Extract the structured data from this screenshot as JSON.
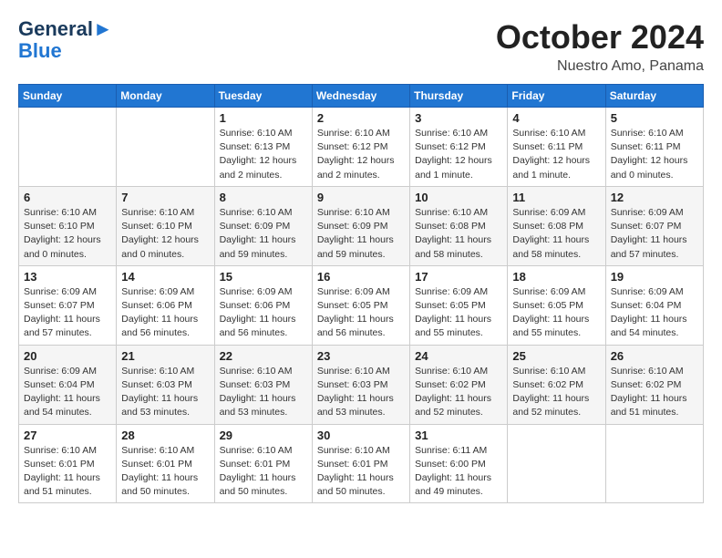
{
  "header": {
    "logo_line1": "General",
    "logo_line2": "Blue",
    "month": "October 2024",
    "location": "Nuestro Amo, Panama"
  },
  "columns": [
    "Sunday",
    "Monday",
    "Tuesday",
    "Wednesday",
    "Thursday",
    "Friday",
    "Saturday"
  ],
  "weeks": [
    [
      {
        "day": "",
        "info": ""
      },
      {
        "day": "",
        "info": ""
      },
      {
        "day": "1",
        "info": "Sunrise: 6:10 AM\nSunset: 6:13 PM\nDaylight: 12 hours\nand 2 minutes."
      },
      {
        "day": "2",
        "info": "Sunrise: 6:10 AM\nSunset: 6:12 PM\nDaylight: 12 hours\nand 2 minutes."
      },
      {
        "day": "3",
        "info": "Sunrise: 6:10 AM\nSunset: 6:12 PM\nDaylight: 12 hours\nand 1 minute."
      },
      {
        "day": "4",
        "info": "Sunrise: 6:10 AM\nSunset: 6:11 PM\nDaylight: 12 hours\nand 1 minute."
      },
      {
        "day": "5",
        "info": "Sunrise: 6:10 AM\nSunset: 6:11 PM\nDaylight: 12 hours\nand 0 minutes."
      }
    ],
    [
      {
        "day": "6",
        "info": "Sunrise: 6:10 AM\nSunset: 6:10 PM\nDaylight: 12 hours\nand 0 minutes."
      },
      {
        "day": "7",
        "info": "Sunrise: 6:10 AM\nSunset: 6:10 PM\nDaylight: 12 hours\nand 0 minutes."
      },
      {
        "day": "8",
        "info": "Sunrise: 6:10 AM\nSunset: 6:09 PM\nDaylight: 11 hours\nand 59 minutes."
      },
      {
        "day": "9",
        "info": "Sunrise: 6:10 AM\nSunset: 6:09 PM\nDaylight: 11 hours\nand 59 minutes."
      },
      {
        "day": "10",
        "info": "Sunrise: 6:10 AM\nSunset: 6:08 PM\nDaylight: 11 hours\nand 58 minutes."
      },
      {
        "day": "11",
        "info": "Sunrise: 6:09 AM\nSunset: 6:08 PM\nDaylight: 11 hours\nand 58 minutes."
      },
      {
        "day": "12",
        "info": "Sunrise: 6:09 AM\nSunset: 6:07 PM\nDaylight: 11 hours\nand 57 minutes."
      }
    ],
    [
      {
        "day": "13",
        "info": "Sunrise: 6:09 AM\nSunset: 6:07 PM\nDaylight: 11 hours\nand 57 minutes."
      },
      {
        "day": "14",
        "info": "Sunrise: 6:09 AM\nSunset: 6:06 PM\nDaylight: 11 hours\nand 56 minutes."
      },
      {
        "day": "15",
        "info": "Sunrise: 6:09 AM\nSunset: 6:06 PM\nDaylight: 11 hours\nand 56 minutes."
      },
      {
        "day": "16",
        "info": "Sunrise: 6:09 AM\nSunset: 6:05 PM\nDaylight: 11 hours\nand 56 minutes."
      },
      {
        "day": "17",
        "info": "Sunrise: 6:09 AM\nSunset: 6:05 PM\nDaylight: 11 hours\nand 55 minutes."
      },
      {
        "day": "18",
        "info": "Sunrise: 6:09 AM\nSunset: 6:05 PM\nDaylight: 11 hours\nand 55 minutes."
      },
      {
        "day": "19",
        "info": "Sunrise: 6:09 AM\nSunset: 6:04 PM\nDaylight: 11 hours\nand 54 minutes."
      }
    ],
    [
      {
        "day": "20",
        "info": "Sunrise: 6:09 AM\nSunset: 6:04 PM\nDaylight: 11 hours\nand 54 minutes."
      },
      {
        "day": "21",
        "info": "Sunrise: 6:10 AM\nSunset: 6:03 PM\nDaylight: 11 hours\nand 53 minutes."
      },
      {
        "day": "22",
        "info": "Sunrise: 6:10 AM\nSunset: 6:03 PM\nDaylight: 11 hours\nand 53 minutes."
      },
      {
        "day": "23",
        "info": "Sunrise: 6:10 AM\nSunset: 6:03 PM\nDaylight: 11 hours\nand 53 minutes."
      },
      {
        "day": "24",
        "info": "Sunrise: 6:10 AM\nSunset: 6:02 PM\nDaylight: 11 hours\nand 52 minutes."
      },
      {
        "day": "25",
        "info": "Sunrise: 6:10 AM\nSunset: 6:02 PM\nDaylight: 11 hours\nand 52 minutes."
      },
      {
        "day": "26",
        "info": "Sunrise: 6:10 AM\nSunset: 6:02 PM\nDaylight: 11 hours\nand 51 minutes."
      }
    ],
    [
      {
        "day": "27",
        "info": "Sunrise: 6:10 AM\nSunset: 6:01 PM\nDaylight: 11 hours\nand 51 minutes."
      },
      {
        "day": "28",
        "info": "Sunrise: 6:10 AM\nSunset: 6:01 PM\nDaylight: 11 hours\nand 50 minutes."
      },
      {
        "day": "29",
        "info": "Sunrise: 6:10 AM\nSunset: 6:01 PM\nDaylight: 11 hours\nand 50 minutes."
      },
      {
        "day": "30",
        "info": "Sunrise: 6:10 AM\nSunset: 6:01 PM\nDaylight: 11 hours\nand 50 minutes."
      },
      {
        "day": "31",
        "info": "Sunrise: 6:11 AM\nSunset: 6:00 PM\nDaylight: 11 hours\nand 49 minutes."
      },
      {
        "day": "",
        "info": ""
      },
      {
        "day": "",
        "info": ""
      }
    ]
  ]
}
